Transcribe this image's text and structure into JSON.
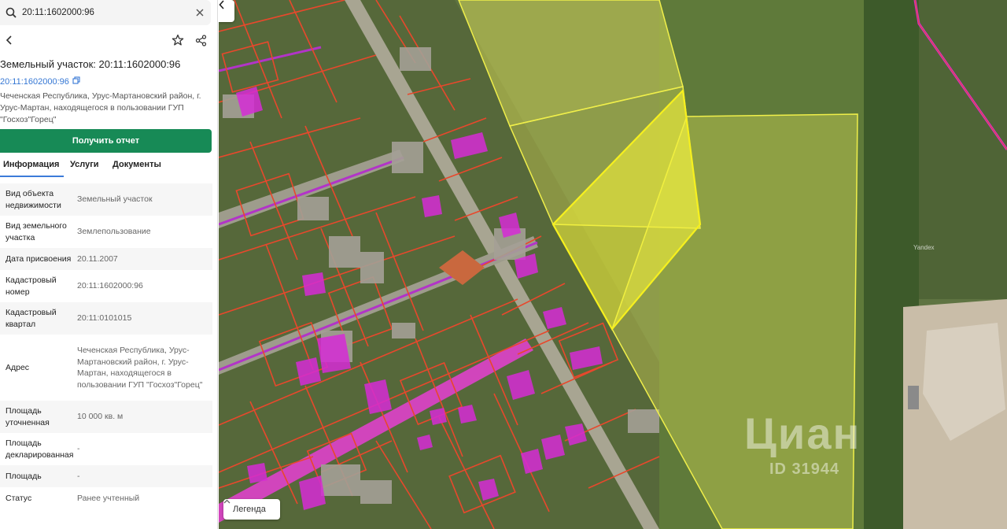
{
  "search": {
    "value": "20:11:1602000:96"
  },
  "object": {
    "title": "Земельный участок: 20:11:1602000:96",
    "cadastral_link": "20:11:1602000:96",
    "address": "Чеченская Республика, Урус-Мартановский район, г. Урус-Мартан, находящегося в пользовании ГУП \"Госхоз\"Горец\""
  },
  "report_button": "Получить отчет",
  "tabs": [
    "Информация",
    "Услуги",
    "Документы"
  ],
  "properties": [
    {
      "key": "Вид объекта недвижимости",
      "value": "Земельный участок"
    },
    {
      "key": "Вид земельного участка",
      "value": "Землепользование"
    },
    {
      "key": "Дата присвоения",
      "value": "20.11.2007"
    },
    {
      "key": "Кадастровый номер",
      "value": "20:11:1602000:96"
    },
    {
      "key": "Кадастровый квартал",
      "value": "20:11:0101015"
    },
    {
      "key": "Адрес",
      "value": "Чеченская Республика, Урус-Мартановский район, г. Урус-Мартан, находящегося в пользовании ГУП \"Госхоз\"Горец\""
    },
    {
      "key": "Площадь уточненная",
      "value": "10 000 кв. м"
    },
    {
      "key": "Площадь декларированная",
      "value": "-"
    },
    {
      "key": "Площадь",
      "value": "-"
    },
    {
      "key": "Статус",
      "value": "Ранее учтенный"
    }
  ],
  "map": {
    "legend_label": "Легенда",
    "watermarks": {
      "yandex": "Yandex",
      "cian": "Циан",
      "cian_id": "ID 31944"
    }
  },
  "colors": {
    "accent_green": "#178a56",
    "link_blue": "#3577d4",
    "parcel_border": "#e8482c",
    "selected_parcel": "#f2f03a",
    "building_magenta": "#d62bd6"
  },
  "icons": [
    "search-icon",
    "close-icon",
    "back-icon",
    "star-icon",
    "share-icon",
    "copy-icon",
    "chevron-left-icon",
    "chevron-up-icon"
  ]
}
